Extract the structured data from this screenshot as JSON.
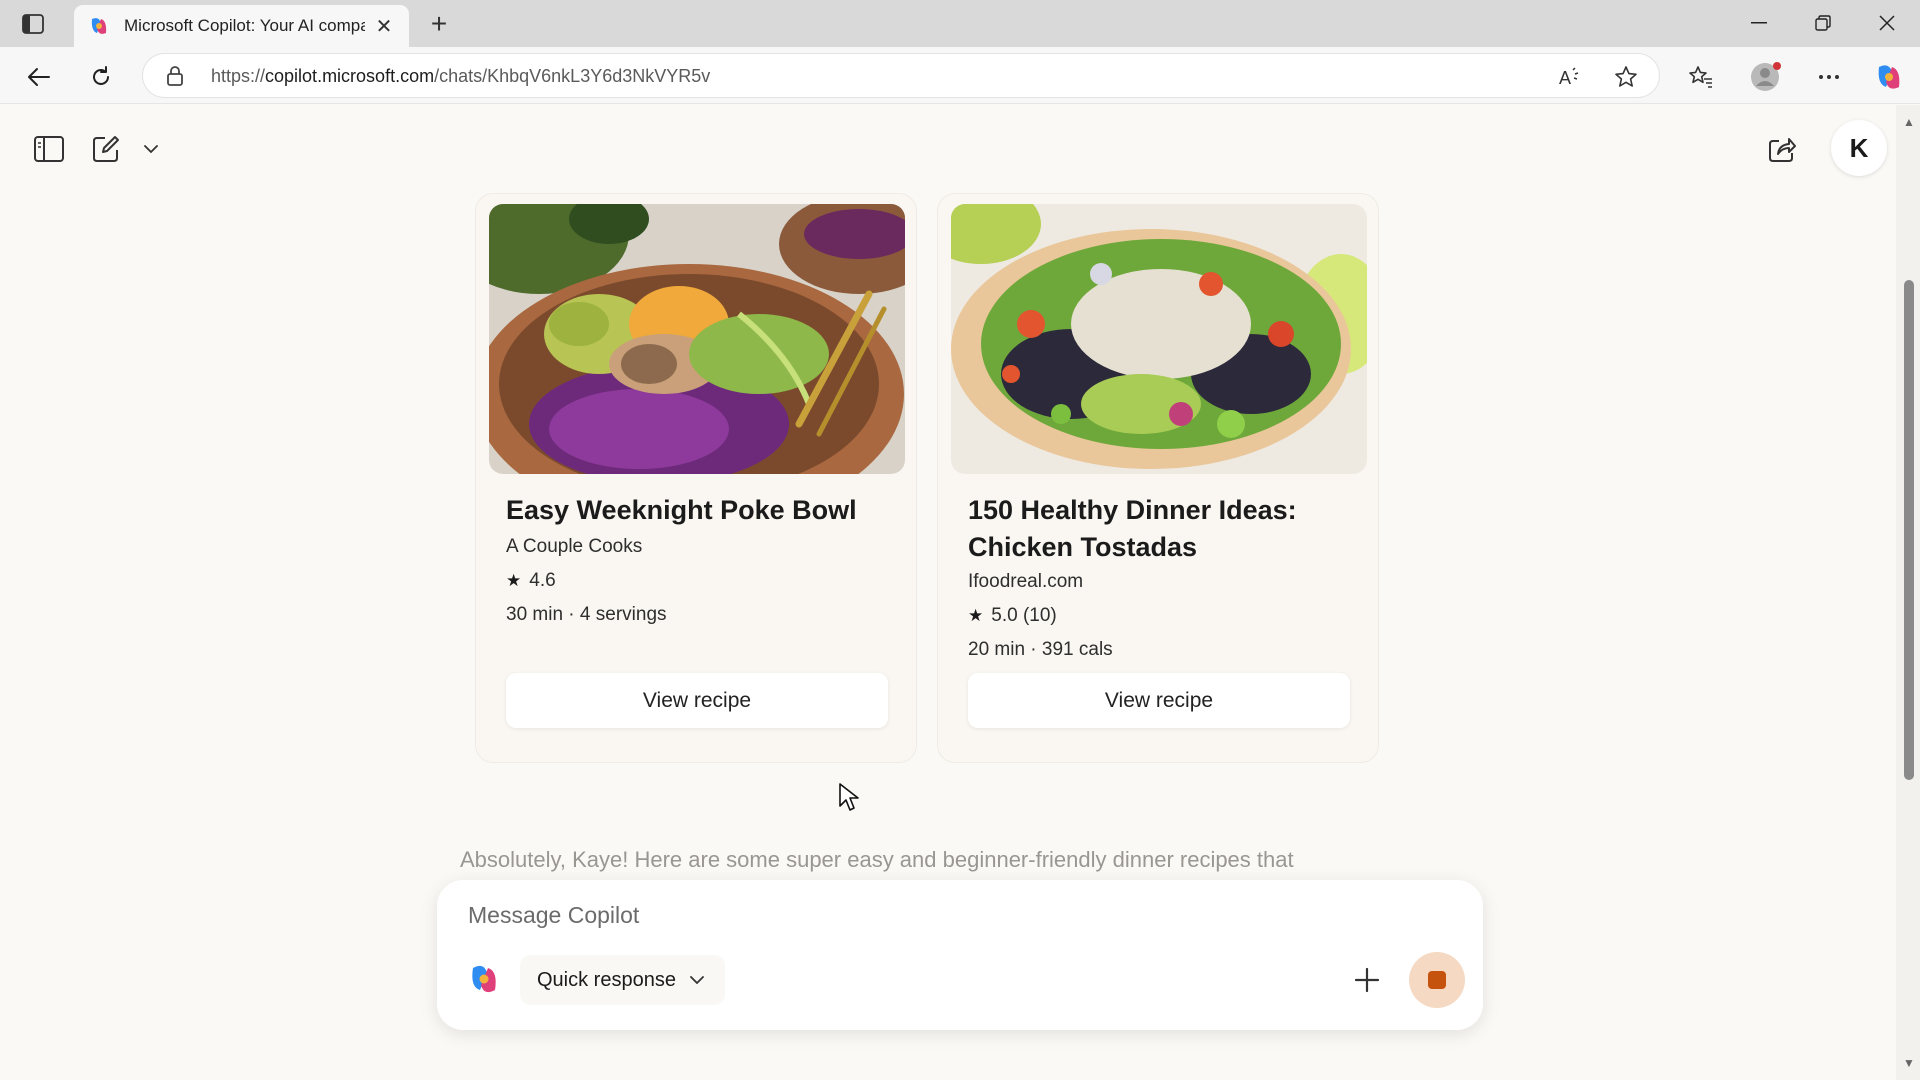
{
  "browser": {
    "tab_title": "Microsoft Copilot: Your AI compa",
    "url_prefix": "https://",
    "url_host": "copilot.microsoft.com",
    "url_path": "/chats/KhbqV6nkL3Y6d3NkVYR5v"
  },
  "icons": {
    "tab_toggle": "tab-actions-icon",
    "favicon": "copilot-icon",
    "back": "back-arrow-icon",
    "refresh": "refresh-icon",
    "lock": "lock-icon",
    "read_aloud": "read-aloud-icon",
    "favorite": "star-icon",
    "favorites_bar": "favorites-icon",
    "profile": "profile-icon",
    "more": "more-icon",
    "copilot_sidebar": "copilot-icon",
    "sidebar_toggle": "sidebar-icon",
    "new_chat": "compose-icon",
    "share": "share-icon",
    "add": "plus-icon",
    "stop": "stop-icon"
  },
  "copilot": {
    "user_initial": "K",
    "cards": [
      {
        "title": "Easy Weeknight Poke Bowl",
        "source": "A Couple Cooks",
        "rating": "4.6",
        "details": "30 min · 4 servings",
        "button": "View recipe"
      },
      {
        "title": "150 Healthy Dinner Ideas: Chicken Tostadas",
        "source": "Ifoodreal.com",
        "rating": "5.0 (10)",
        "details": "20 min · 391 cals",
        "button": "View recipe"
      }
    ],
    "response_preview": "Absolutely, Kaye! Here are some super easy and beginner-friendly dinner recipes that",
    "composer": {
      "placeholder": "Message Copilot",
      "mode": "Quick response"
    }
  },
  "colors": {
    "page_bg": "#fbf9f5",
    "stop_button_bg": "#f5d9c3",
    "stop_button_fg": "#c5530e"
  }
}
